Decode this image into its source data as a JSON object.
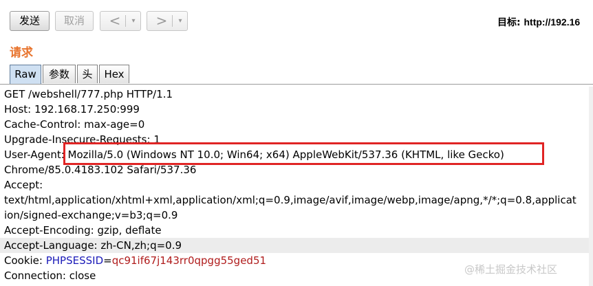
{
  "toolbar": {
    "send_label": "发送",
    "cancel_label": "取消",
    "back_arrow": "<",
    "forward_arrow": ">",
    "caret": "▾",
    "target_label": "目标:",
    "target_url": "http://192.16"
  },
  "request": {
    "title": "请求",
    "tabs": [
      {
        "label": "Raw",
        "active": true
      },
      {
        "label": "参数",
        "active": false
      },
      {
        "label": "头",
        "active": false
      },
      {
        "label": "Hex",
        "active": false
      }
    ],
    "lines": [
      "GET /webshell/777.php HTTP/1.1",
      "Host: 192.168.17.250:999",
      "Cache-Control: max-age=0",
      "Upgrade-Insecure-Requests: 1",
      "User-Agent: Mozilla/5.0 (Windows NT 10.0; Win64; x64) AppleWebKit/537.36 (KHTML, like Gecko)",
      "Chrome/85.0.4183.102 Safari/537.36",
      "Accept:",
      "text/html,application/xhtml+xml,application/xml;q=0.9,image/avif,image/webp,image/apng,*/*;q=0.8,applicat",
      "ion/signed-exchange;v=b3;q=0.9",
      "Accept-Encoding: gzip, deflate",
      "Accept-Language: zh-CN,zh;q=0.9"
    ],
    "cookie": {
      "prefix": "Cookie: ",
      "name": "PHPSESSID",
      "eq": "=",
      "value": "qc91if67j143rr0qpgg55ged51"
    },
    "last_line": "Connection: close",
    "highlight_color": "#e02424"
  },
  "watermark": "@稀土掘金技术社区"
}
